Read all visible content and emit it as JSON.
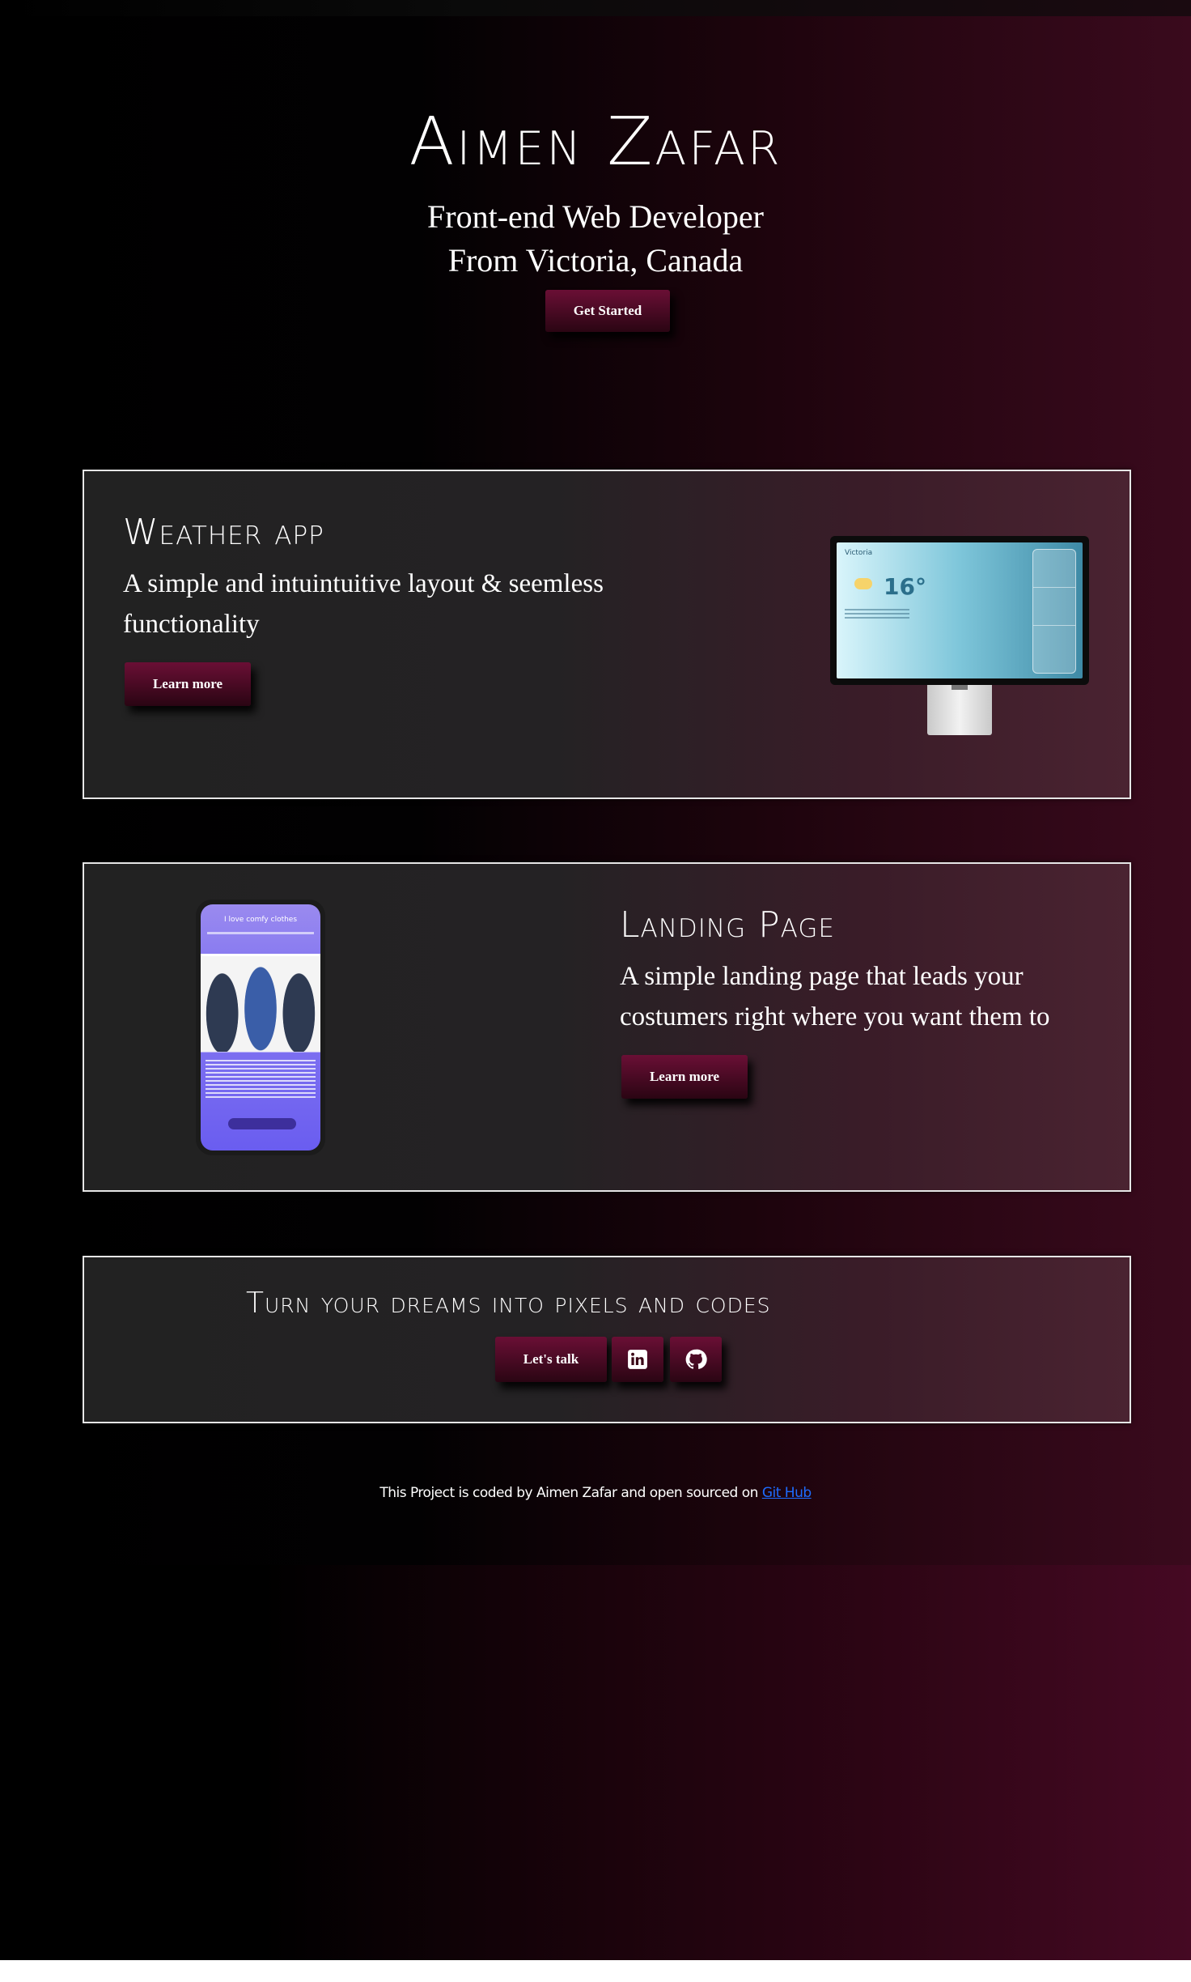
{
  "hero": {
    "name": "Aimen Zafar",
    "role": "Front-end Web Developer",
    "location": "From Victoria, Canada",
    "cta_label": "Get Started"
  },
  "projects": [
    {
      "title": "Weather app",
      "description": "A simple and intuintuitive layout & seemless functionality",
      "button_label": "Learn more",
      "preview": {
        "city": "Victoria",
        "temperature": "16°"
      }
    },
    {
      "title": "Landing Page",
      "description": "A simple landing page that leads your costumers right where you want them to",
      "button_label": "Learn more",
      "preview": {
        "headline": "I love comfy clothes"
      }
    }
  ],
  "cta": {
    "title": "Turn your dreams into pixels and codes",
    "talk_label": "Let's talk",
    "icons": [
      "linkedin-icon",
      "github-icon"
    ]
  },
  "footer": {
    "text": "This Project is coded by Aimen Zafar and open sourced on",
    "link_label": "Git Hub"
  },
  "colors": {
    "button_top": "#6a0f35",
    "button_bottom": "#2a0513",
    "link": "#1e6cff",
    "card_border": "#e6e6e6"
  }
}
